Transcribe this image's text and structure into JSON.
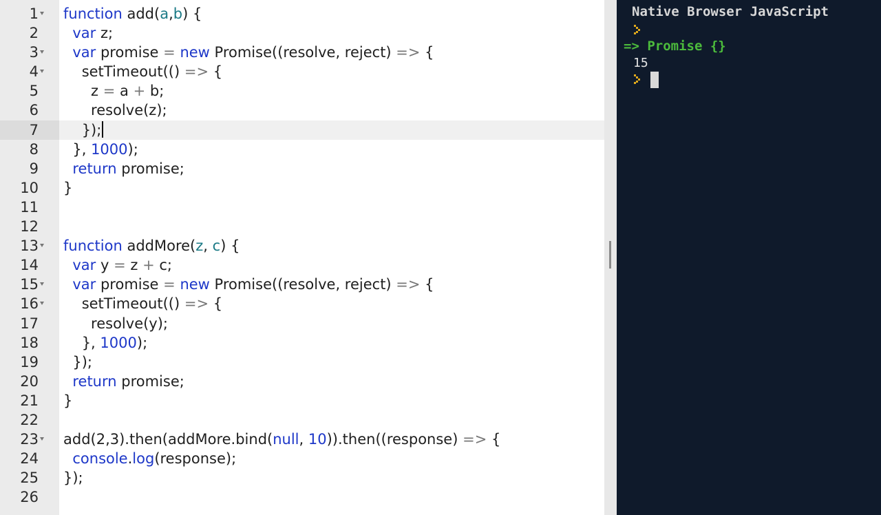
{
  "editor": {
    "active_line": 7,
    "lines": [
      {
        "num": "1",
        "fold": true,
        "tokens": [
          {
            "t": "kw",
            "v": "function"
          },
          {
            "t": "plain",
            "v": " add("
          },
          {
            "t": "arg",
            "v": "a"
          },
          {
            "t": "plain",
            "v": ","
          },
          {
            "t": "arg",
            "v": "b"
          },
          {
            "t": "plain",
            "v": ") {"
          }
        ]
      },
      {
        "num": "2",
        "fold": false,
        "tokens": [
          {
            "t": "plain",
            "v": "  "
          },
          {
            "t": "kw",
            "v": "var"
          },
          {
            "t": "plain",
            "v": " z;"
          }
        ]
      },
      {
        "num": "3",
        "fold": true,
        "tokens": [
          {
            "t": "plain",
            "v": "  "
          },
          {
            "t": "kw",
            "v": "var"
          },
          {
            "t": "plain",
            "v": " promise "
          },
          {
            "t": "op",
            "v": "="
          },
          {
            "t": "plain",
            "v": " "
          },
          {
            "t": "kw",
            "v": "new"
          },
          {
            "t": "plain",
            "v": " Promise((resolve, reject) "
          },
          {
            "t": "op",
            "v": "=>"
          },
          {
            "t": "plain",
            "v": " {"
          }
        ]
      },
      {
        "num": "4",
        "fold": true,
        "tokens": [
          {
            "t": "plain",
            "v": "    setTimeout(() "
          },
          {
            "t": "op",
            "v": "=>"
          },
          {
            "t": "plain",
            "v": " {"
          }
        ]
      },
      {
        "num": "5",
        "fold": false,
        "tokens": [
          {
            "t": "plain",
            "v": "      z "
          },
          {
            "t": "op",
            "v": "="
          },
          {
            "t": "plain",
            "v": " a "
          },
          {
            "t": "op",
            "v": "+"
          },
          {
            "t": "plain",
            "v": " b;"
          }
        ]
      },
      {
        "num": "6",
        "fold": false,
        "tokens": [
          {
            "t": "plain",
            "v": "      resolve(z);"
          }
        ]
      },
      {
        "num": "7",
        "fold": false,
        "caret": true,
        "tokens": [
          {
            "t": "plain",
            "v": "    });"
          }
        ]
      },
      {
        "num": "8",
        "fold": false,
        "tokens": [
          {
            "t": "plain",
            "v": "  }, "
          },
          {
            "t": "num",
            "v": "1000"
          },
          {
            "t": "plain",
            "v": ");"
          }
        ]
      },
      {
        "num": "9",
        "fold": false,
        "tokens": [
          {
            "t": "plain",
            "v": "  "
          },
          {
            "t": "kw",
            "v": "return"
          },
          {
            "t": "plain",
            "v": " promise;"
          }
        ]
      },
      {
        "num": "10",
        "fold": false,
        "tokens": [
          {
            "t": "plain",
            "v": "}"
          }
        ]
      },
      {
        "num": "11",
        "fold": false,
        "tokens": []
      },
      {
        "num": "12",
        "fold": false,
        "tokens": []
      },
      {
        "num": "13",
        "fold": true,
        "tokens": [
          {
            "t": "kw",
            "v": "function"
          },
          {
            "t": "plain",
            "v": " addMore("
          },
          {
            "t": "arg",
            "v": "z"
          },
          {
            "t": "plain",
            "v": ", "
          },
          {
            "t": "arg",
            "v": "c"
          },
          {
            "t": "plain",
            "v": ") {"
          }
        ]
      },
      {
        "num": "14",
        "fold": false,
        "tokens": [
          {
            "t": "plain",
            "v": "  "
          },
          {
            "t": "kw",
            "v": "var"
          },
          {
            "t": "plain",
            "v": " y "
          },
          {
            "t": "op",
            "v": "="
          },
          {
            "t": "plain",
            "v": " z "
          },
          {
            "t": "op",
            "v": "+"
          },
          {
            "t": "plain",
            "v": " c;"
          }
        ]
      },
      {
        "num": "15",
        "fold": true,
        "tokens": [
          {
            "t": "plain",
            "v": "  "
          },
          {
            "t": "kw",
            "v": "var"
          },
          {
            "t": "plain",
            "v": " promise "
          },
          {
            "t": "op",
            "v": "="
          },
          {
            "t": "plain",
            "v": " "
          },
          {
            "t": "kw",
            "v": "new"
          },
          {
            "t": "plain",
            "v": " Promise((resolve, reject) "
          },
          {
            "t": "op",
            "v": "=>"
          },
          {
            "t": "plain",
            "v": " {"
          }
        ]
      },
      {
        "num": "16",
        "fold": true,
        "tokens": [
          {
            "t": "plain",
            "v": "    setTimeout(() "
          },
          {
            "t": "op",
            "v": "=>"
          },
          {
            "t": "plain",
            "v": " {"
          }
        ]
      },
      {
        "num": "17",
        "fold": false,
        "tokens": [
          {
            "t": "plain",
            "v": "      resolve(y);"
          }
        ]
      },
      {
        "num": "18",
        "fold": false,
        "tokens": [
          {
            "t": "plain",
            "v": "    }, "
          },
          {
            "t": "num",
            "v": "1000"
          },
          {
            "t": "plain",
            "v": ");"
          }
        ]
      },
      {
        "num": "19",
        "fold": false,
        "tokens": [
          {
            "t": "plain",
            "v": "  });"
          }
        ]
      },
      {
        "num": "20",
        "fold": false,
        "tokens": [
          {
            "t": "plain",
            "v": "  "
          },
          {
            "t": "kw",
            "v": "return"
          },
          {
            "t": "plain",
            "v": " promise;"
          }
        ]
      },
      {
        "num": "21",
        "fold": false,
        "tokens": [
          {
            "t": "plain",
            "v": "}"
          }
        ]
      },
      {
        "num": "22",
        "fold": false,
        "tokens": []
      },
      {
        "num": "23",
        "fold": true,
        "tokens": [
          {
            "t": "plain",
            "v": "add(2,3).then(addMore.bind("
          },
          {
            "t": "kw",
            "v": "null"
          },
          {
            "t": "plain",
            "v": ", "
          },
          {
            "t": "num",
            "v": "10"
          },
          {
            "t": "plain",
            "v": ")).then((response) "
          },
          {
            "t": "op",
            "v": "=>"
          },
          {
            "t": "plain",
            "v": " {"
          }
        ]
      },
      {
        "num": "24",
        "fold": false,
        "tokens": [
          {
            "t": "plain",
            "v": "  "
          },
          {
            "t": "prop",
            "v": "console"
          },
          {
            "t": "plain",
            "v": "."
          },
          {
            "t": "prop",
            "v": "log"
          },
          {
            "t": "plain",
            "v": "(response);"
          }
        ]
      },
      {
        "num": "25",
        "fold": false,
        "tokens": [
          {
            "t": "plain",
            "v": "});"
          }
        ]
      },
      {
        "num": "26",
        "fold": false,
        "tokens": []
      }
    ]
  },
  "console": {
    "title": "Native Browser JavaScript",
    "result": "=> Promise {}",
    "output": "15",
    "colors": {
      "background": "#0f1a2b",
      "result": "#4cbb3c",
      "prompt_icon": "#e0a91c"
    }
  },
  "colors": {
    "keyword": "#1d37c8",
    "argument": "#1b7a86",
    "operator": "#777777",
    "gutter": "#ebebeb"
  }
}
